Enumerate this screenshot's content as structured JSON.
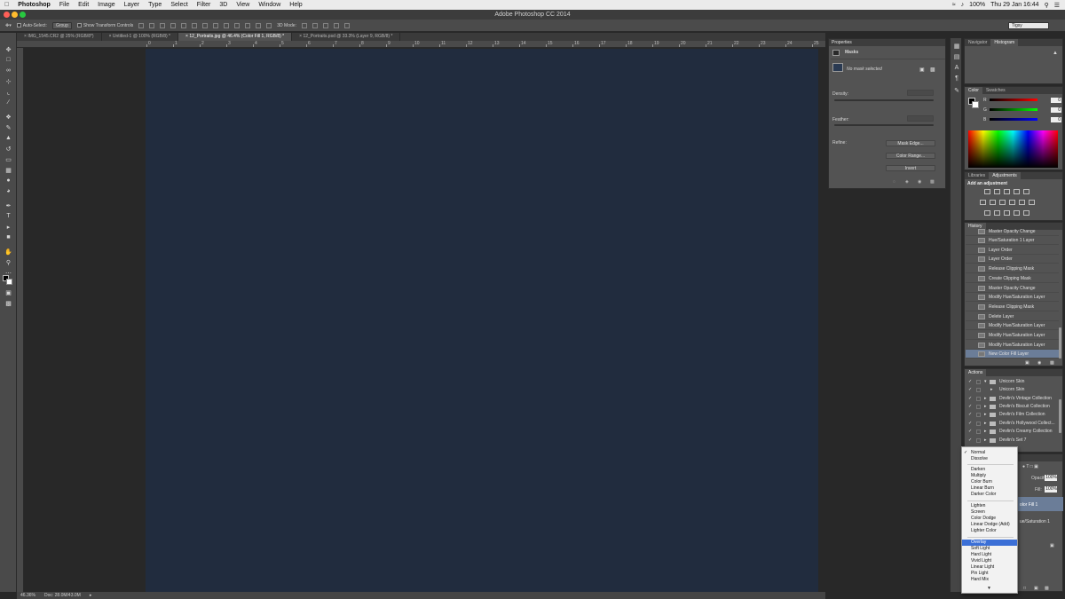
{
  "menubar": {
    "apple": "",
    "items": [
      "Photoshop",
      "File",
      "Edit",
      "Image",
      "Layer",
      "Type",
      "Select",
      "Filter",
      "3D",
      "View",
      "Window",
      "Help"
    ],
    "battery": "100%",
    "clock": "Thu 29 Jan  16:44"
  },
  "window": {
    "title": "Adobe Photoshop CC 2014"
  },
  "options": {
    "auto_select_label": "Auto-Select:",
    "auto_select_value": "Group",
    "show_transform": "Show Transform Controls",
    "mode_3d": "3D Mode:",
    "workspace": "Tigsy"
  },
  "tabs": [
    "IMG_1545.CR2 @ 25% (RGB/8*)",
    "Untitled-1 @ 100% (RGB/8) *",
    "12_Portraits.jpg @ 46.4% (Color Fill 1, RGB/8) *",
    "12_Portraits.psd @ 33.3% (Layer 9, RGB/8) *"
  ],
  "ruler": [
    "0",
    "1",
    "2",
    "3",
    "4",
    "5",
    "6",
    "7",
    "8",
    "9",
    "10",
    "11",
    "12",
    "13",
    "14",
    "15",
    "16",
    "17",
    "18",
    "19",
    "20",
    "21",
    "22",
    "23",
    "24",
    "25"
  ],
  "status": {
    "zoom": "46.36%",
    "doc": "Doc: 28.0M/43.0M"
  },
  "properties": {
    "title": "Properties",
    "masks_label": "Masks",
    "no_mask": "No mask selected",
    "density": "Density:",
    "feather": "Feather:",
    "refine": "Refine:",
    "mask_edge": "Mask Edge...",
    "color_range": "Color Range...",
    "invert": "Invert"
  },
  "navigator": {
    "tabs": [
      "Navigator",
      "Histogram"
    ]
  },
  "color_panel": {
    "tabs": [
      "Color",
      "Swatches"
    ],
    "r_label": "R",
    "g_label": "G",
    "b_label": "B",
    "r": "0",
    "g": "0",
    "b": "0"
  },
  "adjustments": {
    "tabs": [
      "Libraries",
      "Adjustments"
    ],
    "add_label": "Add an adjustment"
  },
  "history": {
    "title": "History",
    "items": [
      "Master Opacity Change",
      "Hue/Saturation 1 Layer",
      "Layer Order",
      "Layer Order",
      "Release Clipping Mask",
      "Create Clipping Mask",
      "Master Opacity Change",
      "Modify Hue/Saturation Layer",
      "Release Clipping Mask",
      "Delete Layer",
      "Modify Hue/Saturation Layer",
      "Modify Hue/Saturation Layer",
      "Modify Hue/Saturation Layer",
      "New Color Fill Layer"
    ]
  },
  "actions": {
    "title": "Actions",
    "items": [
      "Unicorn Skin",
      "Unicorn Skin",
      "Devlin's Vintage Collection",
      "Devlin's Biscuit Collection",
      "Devlin's Film Collection",
      "Devlin's Hollywood Collect...",
      "Devlin's Creamy Collection",
      "Devlin's Set 7"
    ]
  },
  "layers": {
    "opacity_label": "Opacity:",
    "opacity": "100%",
    "fill_label": "Fill:",
    "fill": "100%",
    "layer1": "olor Fill 1",
    "layer2": "ue/Saturation 1"
  },
  "blend_modes": {
    "selected": "Overlay",
    "groups": [
      [
        "Normal",
        "Dissolve"
      ],
      [
        "Darken",
        "Multiply",
        "Color Burn",
        "Linear Burn",
        "Darker Color"
      ],
      [
        "Lighten",
        "Screen",
        "Color Dodge",
        "Linear Dodge (Add)",
        "Lighter Color"
      ],
      [
        "Overlay",
        "Soft Light",
        "Hard Light",
        "Vivid Light",
        "Linear Light",
        "Pin Light",
        "Hard Mix"
      ]
    ]
  },
  "colors": {
    "canvas": "#212c3e",
    "highlight": "#3b6fd6"
  }
}
